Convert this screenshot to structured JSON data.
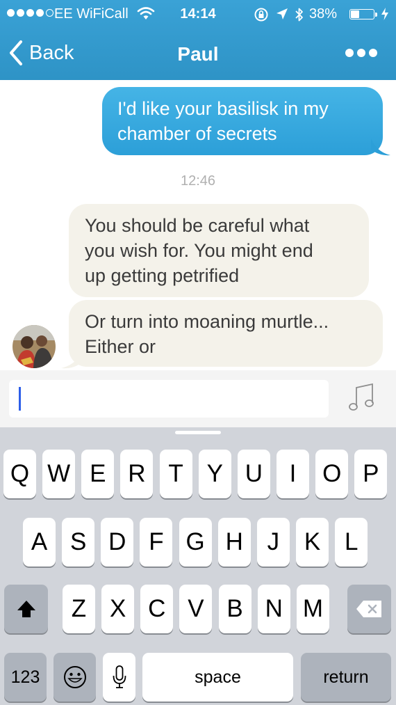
{
  "status_bar": {
    "carrier": "EE WiFiCall",
    "time": "14:14",
    "battery_percent": "38%",
    "battery_level": 0.38,
    "signal_bars_filled": 4,
    "icons": [
      "wifi-icon",
      "rotation-lock-icon",
      "location-arrow-icon",
      "bluetooth-icon",
      "battery-icon",
      "charging-icon"
    ]
  },
  "nav": {
    "back_label": "Back",
    "title": "Paul",
    "icons": [
      "back-chevron-icon",
      "more-dots-icon"
    ]
  },
  "messages": [
    {
      "direction": "outgoing",
      "text": "I'd like your basilisk in my\nchamber of secrets"
    },
    {
      "type": "timestamp",
      "text": "12:46"
    },
    {
      "direction": "incoming",
      "text": "You should be careful what\nyou wish for. You might end\nup getting  petrified"
    },
    {
      "direction": "incoming",
      "text": "Or turn into moaning murtle...\nEither or"
    }
  ],
  "input": {
    "value": "",
    "icons": [
      "music-note-icon"
    ]
  },
  "keyboard": {
    "row1": [
      "Q",
      "W",
      "E",
      "R",
      "T",
      "Y",
      "U",
      "I",
      "O",
      "P"
    ],
    "row2": [
      "A",
      "S",
      "D",
      "F",
      "G",
      "H",
      "J",
      "K",
      "L"
    ],
    "row3": [
      "Z",
      "X",
      "C",
      "V",
      "B",
      "N",
      "M"
    ],
    "numbers_label": "123",
    "space_label": "space",
    "return_label": "return",
    "icons": [
      "shift-icon",
      "backspace-icon",
      "emoji-icon",
      "microphone-icon"
    ]
  },
  "colors": {
    "header": "#3aa2d6",
    "outgoing_bubble": "#34a9e0",
    "incoming_bubble": "#f4f2ea",
    "keyboard_bg": "#d1d4da",
    "caret": "#2d5ee8"
  }
}
